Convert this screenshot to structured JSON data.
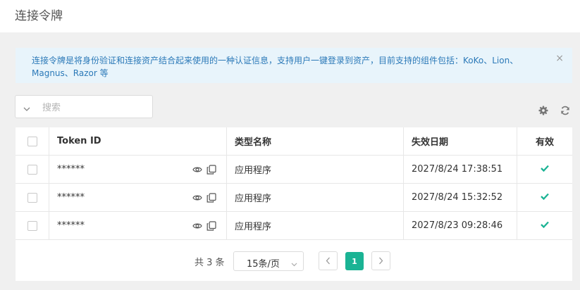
{
  "header": {
    "title": "连接令牌"
  },
  "alert": {
    "text": "连接令牌是将身份验证和连接资产结合起来使用的一种认证信息，支持用户一键登录到资产，目前支持的组件包括：KoKo、Lion、Magnus、Razor 等",
    "close": "×"
  },
  "search": {
    "value": "",
    "placeholder": "搜索"
  },
  "toolbar": {
    "settings_icon": "gear-icon",
    "refresh_icon": "refresh-icon"
  },
  "table": {
    "columns": [
      "Token ID",
      "类型名称",
      "失效日期",
      "有效"
    ],
    "rows": [
      {
        "token": "******",
        "type": "应用程序",
        "expires": "2027/8/24 17:38:51",
        "valid": true
      },
      {
        "token": "******",
        "type": "应用程序",
        "expires": "2027/8/24 15:32:52",
        "valid": true
      },
      {
        "token": "******",
        "type": "应用程序",
        "expires": "2027/8/23 09:28:46",
        "valid": true
      }
    ]
  },
  "pagination": {
    "total_text": "共 3 条",
    "page_size": "15条/页",
    "current_page": "1"
  },
  "colors": {
    "accent": "#1ab394",
    "alert_bg": "#e8f4fb",
    "alert_text": "#2b79b8"
  }
}
